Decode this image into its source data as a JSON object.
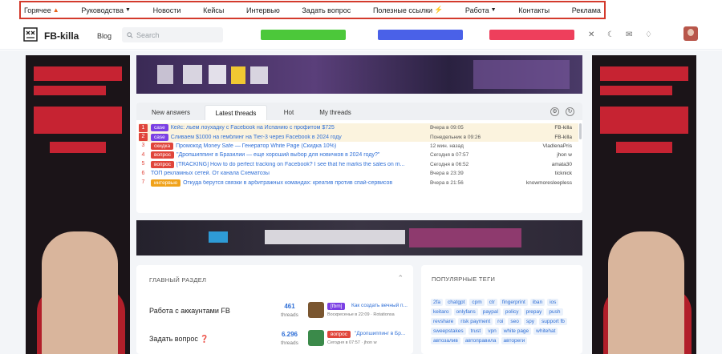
{
  "topnav": [
    {
      "label": "Горячее",
      "icon": "fire-icon"
    },
    {
      "label": "Руководства",
      "icon": "caret-down-icon"
    },
    {
      "label": "Новости"
    },
    {
      "label": "Кейсы"
    },
    {
      "label": "Интервью"
    },
    {
      "label": "Задать вопрос"
    },
    {
      "label": "Полезные ссылки",
      "icon": "bolt-icon"
    },
    {
      "label": "Работа",
      "icon": "caret-down-icon"
    },
    {
      "label": "Контакты"
    },
    {
      "label": "Реклама"
    }
  ],
  "header": {
    "logo": "FB-killa",
    "blog": "Blog",
    "search_placeholder": "Search"
  },
  "threads": {
    "tabs": [
      "New answers",
      "Latest threads",
      "Hot",
      "My threads"
    ],
    "active_tab": "Latest threads",
    "rows": [
      {
        "num": "1",
        "tag": "case",
        "tag_color": "#7b3fe4",
        "title": "Кейс: льем лоухадку с Facebook на Испанию с профитом $725",
        "date": "Вчера в 09:05",
        "user": "FB-killa",
        "highlight": true
      },
      {
        "num": "2",
        "tag": "case",
        "tag_color": "#7b3fe4",
        "title": "Сливаем $1000 на гемблинг на Tier-3 через Facebook в 2024 году",
        "date": "Понедельник в 09:26",
        "user": "FB-killa",
        "highlight": true
      },
      {
        "num": "3",
        "tag": "скидка",
        "tag_color": "#e0453b",
        "title": "Промокод Money Safe — Генератор White Page (Скидка 10%)",
        "date": "12 мин. назад",
        "user": "VladlenaPris",
        "highlight": false
      },
      {
        "num": "4",
        "tag": "вопрос",
        "tag_color": "#e0453b",
        "title": "\"Дропшиппинг в Бразилии — еще хороший выбор для новичков в 2024 году?\"",
        "date": "Сегодня в 07:57",
        "user": "jhon w",
        "highlight": false
      },
      {
        "num": "5",
        "tag": "вопрос",
        "tag_color": "#e0453b",
        "title": "[TRACKING] How to do perfect tracking on Facebook? I see that he marks the sales on m...",
        "date": "Сегодня в 06:52",
        "user": "amata30",
        "highlight": false
      },
      {
        "num": "6",
        "tag": "",
        "tag_color": "",
        "title": "ТОП рекламных сетей. От канала Схематозы",
        "date": "Вчера в 23:39",
        "user": "ticknick",
        "highlight": false
      },
      {
        "num": "7",
        "tag": "интервью",
        "tag_color": "#f0a21a",
        "title": "Откуда берутся связки в арбитражных командах: креатив против спай-сервисов",
        "date": "Вчера в 21:56",
        "user": "knowmoresleepless",
        "highlight": false
      }
    ]
  },
  "main_section": {
    "title": "ГЛАВНЫЙ РАЗДЕЛ",
    "forums": [
      {
        "name": "Работа с аккаунтами FB",
        "count": "461",
        "count_label": "threads",
        "last_tag": "[fbm]",
        "last_tag_color": "#7b3fe4",
        "last_title": "Как создать вечный п...",
        "last_meta": "Воскресенье в 22:09 · Rotationsa"
      },
      {
        "name": "Задать вопрос",
        "icon": "pin-icon",
        "count": "6.296",
        "count_label": "threads",
        "last_tag": "вопрос",
        "last_tag_color": "#e0453b",
        "last_title": "\"Дропшиппинг в Бр...",
        "last_meta": "Сегодня в 07:57 · jhon w"
      }
    ]
  },
  "tags_section": {
    "title": "ПОПУЛЯРНЫЕ ТЕГИ",
    "tags": [
      "2fa",
      "chatgpt",
      "cpm",
      "ctr",
      "fingerprint",
      "iban",
      "ios",
      "keitaro",
      "onlyfans",
      "paypal",
      "policy",
      "prepay",
      "push",
      "revshare",
      "risk payment",
      "roi",
      "seo",
      "spy",
      "support fb",
      "sweepstakes",
      "trust",
      "vpn",
      "white page",
      "whitehat",
      "автозалив",
      "автоправила",
      "автореги"
    ]
  }
}
